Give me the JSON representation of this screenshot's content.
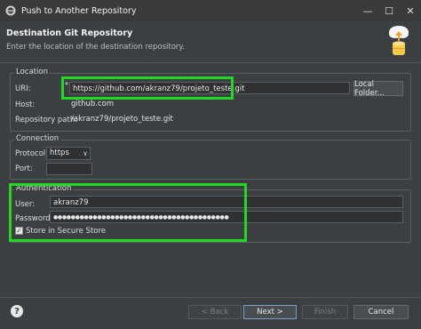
{
  "window": {
    "title": "Push to Another Repository",
    "minimize": "—",
    "maximize": "☐",
    "close": "✕"
  },
  "banner": {
    "title": "Destination Git Repository",
    "subtitle": "Enter the location of the destination repository."
  },
  "location": {
    "legend": "Location",
    "uri_label": "URI:",
    "uri_value": "https://github.com/akranz79/projeto_teste.git",
    "local_folder_button": "Local Folder...",
    "host_label": "Host:",
    "host_value": "github.com",
    "repo_path_label": "Repository path:",
    "repo_path_value": "/akranz79/projeto_teste.git"
  },
  "connection": {
    "legend": "Connection",
    "protocol_label": "Protocol:",
    "protocol_value": "https",
    "port_label": "Port:",
    "port_value": ""
  },
  "authentication": {
    "legend": "Authentication",
    "user_label": "User:",
    "user_value": "akranz79",
    "password_label": "Password:",
    "password_value": "●●●●●●●●●●●●●●●●●●●●●●●●●●●●●●●●●●●●●●●●",
    "store_label": "Store in Secure Store",
    "store_checked": true
  },
  "footer": {
    "help": "?",
    "back": "< Back",
    "next": "Next >",
    "finish": "Finish",
    "cancel": "Cancel"
  },
  "colors": {
    "highlight": "#22d622",
    "background": "#3c3f41"
  }
}
